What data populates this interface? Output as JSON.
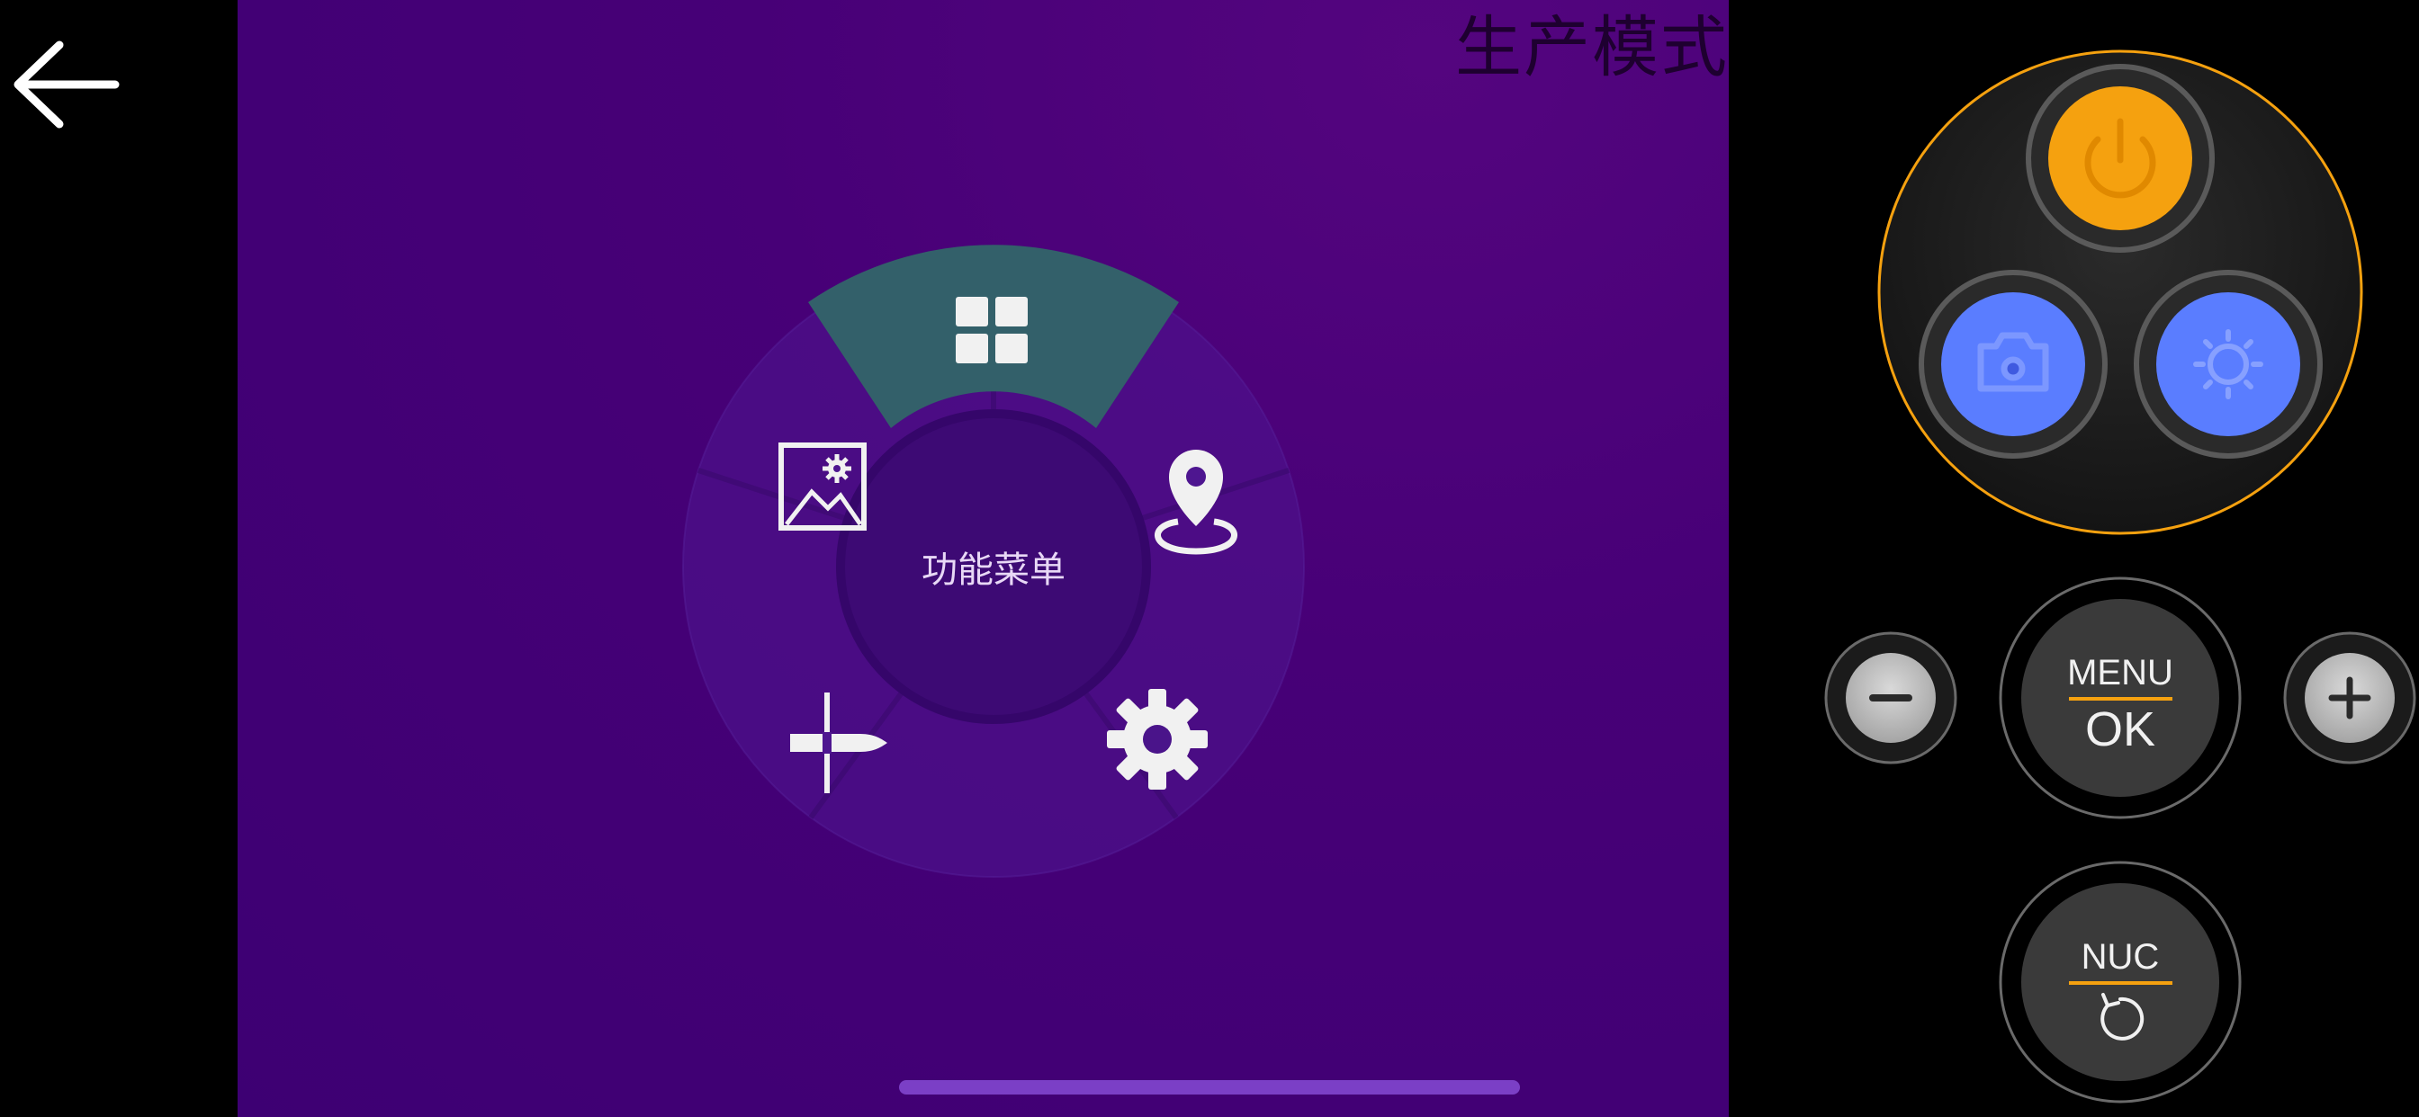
{
  "header": {
    "mode_title": "生产模式"
  },
  "radial_menu": {
    "center_label": "功能菜单",
    "items": [
      {
        "name": "menu-item-grid",
        "icon": "grid-icon",
        "selected": true
      },
      {
        "name": "menu-item-location",
        "icon": "location-pin-icon",
        "selected": false
      },
      {
        "name": "menu-item-settings",
        "icon": "gear-icon",
        "selected": false
      },
      {
        "name": "menu-item-crosshair",
        "icon": "bullet-crosshair-icon",
        "selected": false
      },
      {
        "name": "menu-item-image-settings",
        "icon": "image-gear-icon",
        "selected": false
      }
    ]
  },
  "controls": {
    "power": {
      "icon": "power-icon"
    },
    "capture": {
      "icon": "camera-icon"
    },
    "brightness": {
      "icon": "sun-icon"
    },
    "zoom_out": {
      "icon": "minus-icon"
    },
    "zoom_in": {
      "icon": "plus-icon"
    },
    "menu_ok": {
      "top_label": "MENU",
      "bottom_label": "OK"
    },
    "nuc": {
      "top_label": "NUC",
      "icon": "refresh-icon"
    }
  },
  "colors": {
    "viewer_bg": "#470077",
    "selected_segment": "#33606a",
    "accent_orange": "#f5a10f",
    "button_blue": "#5a7dff",
    "button_dark": "#3a3a3a"
  }
}
